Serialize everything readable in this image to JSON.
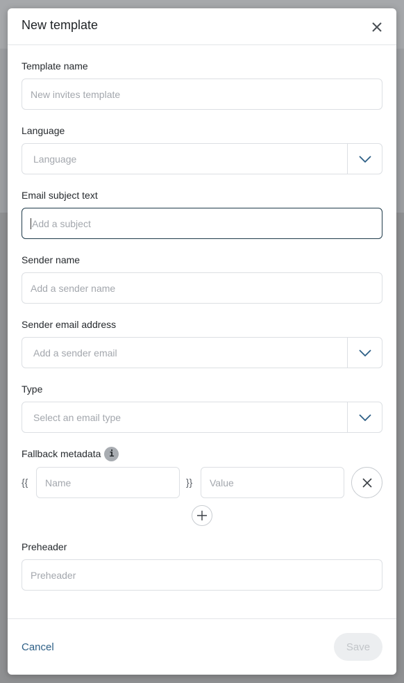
{
  "modal": {
    "title": "New template",
    "close_icon": "close-icon"
  },
  "fields": {
    "template_name": {
      "label": "Template name",
      "placeholder": "New invites template"
    },
    "language": {
      "label": "Language",
      "placeholder": "Language",
      "icon": "chevron-down-icon"
    },
    "email_subject": {
      "label": "Email subject text",
      "placeholder": "Add a subject"
    },
    "sender_name": {
      "label": "Sender name",
      "placeholder": "Add a sender name"
    },
    "sender_email": {
      "label": "Sender email address",
      "placeholder": "Add a sender email",
      "icon": "chevron-down-icon"
    },
    "type": {
      "label": "Type",
      "placeholder": "Select an email type",
      "icon": "chevron-down-icon"
    },
    "fallback_metadata": {
      "label": "Fallback metadata",
      "info_glyph": "i",
      "open_brace": "{{",
      "close_brace": "}}",
      "name_placeholder": "Name",
      "value_placeholder": "Value",
      "remove_icon": "close-icon",
      "add_icon": "plus-icon"
    },
    "preheader": {
      "label": "Preheader",
      "placeholder": "Preheader"
    }
  },
  "footer": {
    "cancel_label": "Cancel",
    "save_label": "Save"
  },
  "colors": {
    "focused_border": "#1f3b4a",
    "link": "#2d5f86",
    "disabled_button_bg": "#eceef0"
  }
}
